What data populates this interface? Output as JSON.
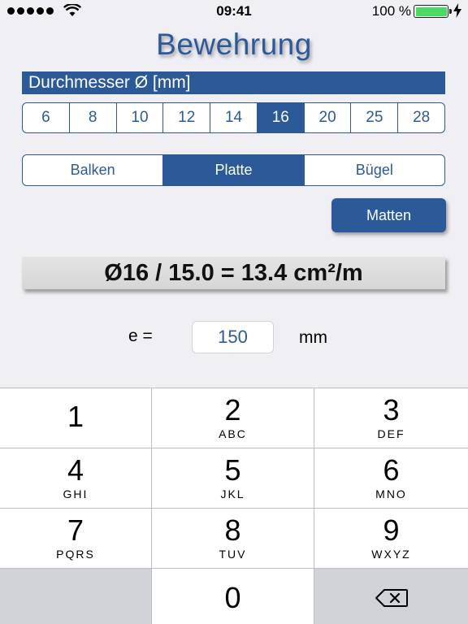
{
  "status_bar": {
    "time": "09:41",
    "battery_percent": "100 %",
    "signal_bars": 5,
    "icons": [
      "signal-dots-icon",
      "wifi-icon",
      "battery-icon",
      "charging-bolt-icon"
    ]
  },
  "title": "Bewehrung",
  "diameter": {
    "header": "Durchmesser  Ø [mm]",
    "options": [
      "6",
      "8",
      "10",
      "12",
      "14",
      "16",
      "20",
      "25",
      "28"
    ],
    "selected": "16"
  },
  "element_type": {
    "options": [
      "Balken",
      "Platte",
      "Bügel"
    ],
    "selected": "Platte"
  },
  "matten_button": "Matten",
  "result": "Ø16 / 15.0 = 13.4 cm²/m",
  "spacing": {
    "label": "e =",
    "value": "150",
    "unit": "mm"
  },
  "keypad": {
    "keys": [
      {
        "digit": "1",
        "letters": ""
      },
      {
        "digit": "2",
        "letters": "ABC"
      },
      {
        "digit": "3",
        "letters": "DEF"
      },
      {
        "digit": "4",
        "letters": "GHI"
      },
      {
        "digit": "5",
        "letters": "JKL"
      },
      {
        "digit": "6",
        "letters": "MNO"
      },
      {
        "digit": "7",
        "letters": "PQRS"
      },
      {
        "digit": "8",
        "letters": "TUV"
      },
      {
        "digit": "9",
        "letters": "WXYZ"
      }
    ],
    "zero": "0",
    "delete_icon": "backspace-icon"
  },
  "colors": {
    "accent": "#2c5a99",
    "background": "#efeff4",
    "key_gray": "#d1d3d8"
  }
}
